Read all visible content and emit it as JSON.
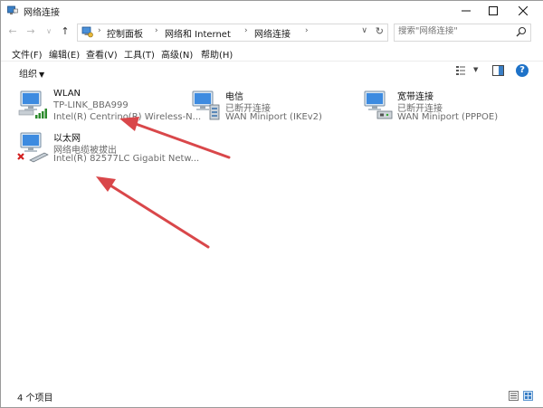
{
  "window": {
    "title": "网络连接"
  },
  "nav": {
    "back": "←",
    "forward": "→",
    "dropdown": "∨",
    "up": "↑"
  },
  "breadcrumb": {
    "items": [
      "控制面板",
      "网络和 Internet",
      "网络连接"
    ],
    "separator": "›"
  },
  "search": {
    "placeholder": "搜索\"网络连接\"",
    "value": ""
  },
  "menu": {
    "items": [
      "文件(F)",
      "编辑(E)",
      "查看(V)",
      "工具(T)",
      "高级(N)",
      "帮助(H)"
    ]
  },
  "toolbar": {
    "organize_label": "组织",
    "organize_caret": "▼",
    "view_caret": "▼",
    "help_label": "?"
  },
  "connections": [
    {
      "name": "WLAN",
      "status": "TP-LINK_BBA999",
      "device": "Intel(R) Centrino(R) Wireless-N...",
      "icon": "wifi-adapter-icon"
    },
    {
      "name": "电信",
      "status": "已断开连接",
      "device": "WAN Miniport (IKEv2)",
      "icon": "vpn-adapter-icon"
    },
    {
      "name": "宽带连接",
      "status": "已断开连接",
      "device": "WAN Miniport (PPPOE)",
      "icon": "broadband-adapter-icon"
    },
    {
      "name": "以太网",
      "status": "网络电缆被拔出",
      "device": "Intel(R) 82577LC Gigabit Netw...",
      "icon": "ethernet-adapter-icon"
    }
  ],
  "statusbar": {
    "item_count": "4 个项目"
  },
  "colors": {
    "annotation_arrow": "#d9474a",
    "signal": "#2e8b2e",
    "disconnected": "#d22020",
    "monitor": "#2f7fd0"
  }
}
